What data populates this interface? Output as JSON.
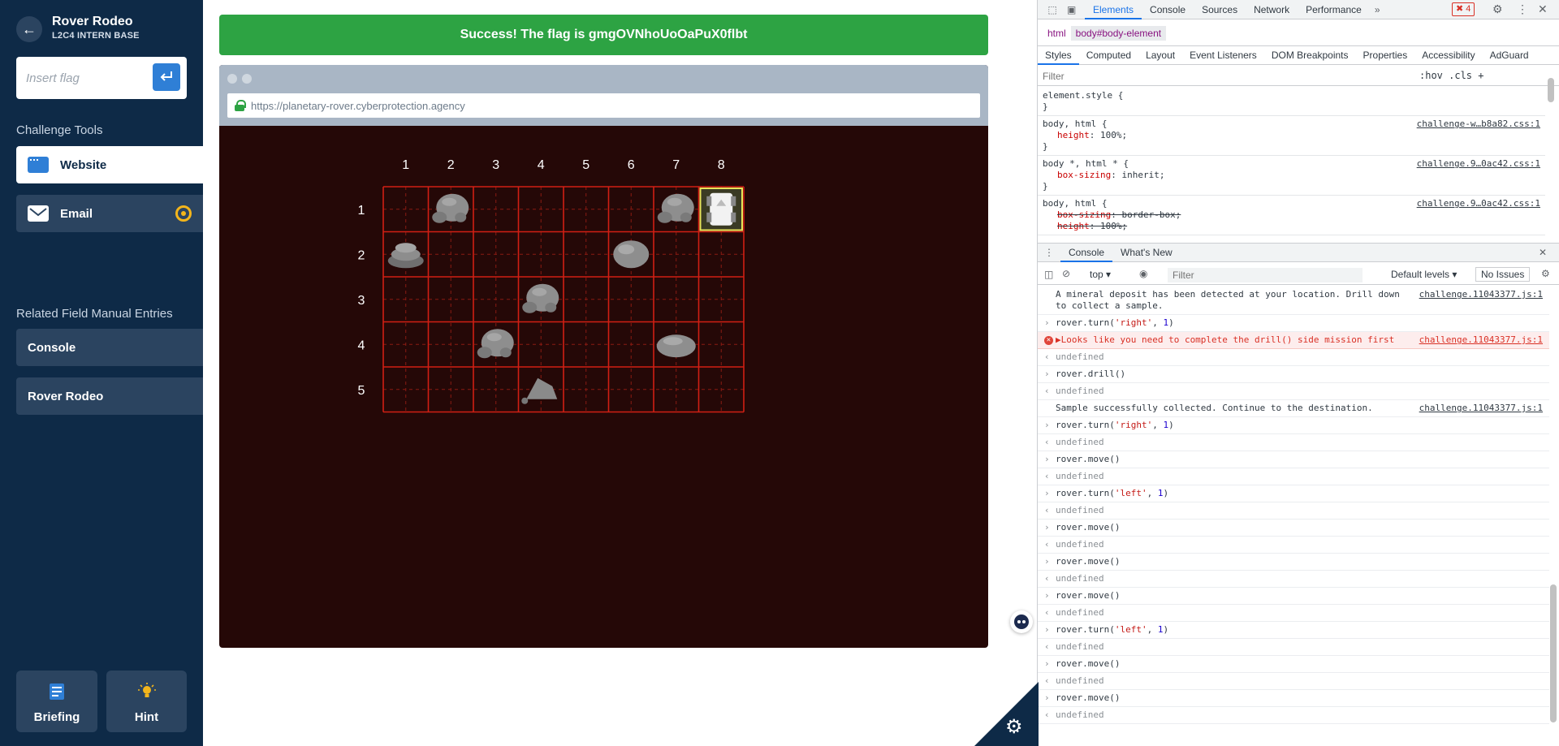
{
  "sidebar": {
    "title": "Rover Rodeo",
    "subtitle": "L2C4 INTERN BASE",
    "flag_placeholder": "Insert flag",
    "tools_heading": "Challenge Tools",
    "tools": [
      {
        "label": "Website",
        "icon": "browser-window-icon"
      },
      {
        "label": "Email",
        "icon": "envelope-icon"
      }
    ],
    "entries_heading": "Related Field Manual Entries",
    "entries": [
      {
        "label": "Console"
      },
      {
        "label": "Rover Rodeo"
      }
    ],
    "briefing_label": "Briefing",
    "hint_label": "Hint"
  },
  "success": {
    "message": "Success! The flag is gmgOVNhoUoOaPuX0flbt",
    "color": "#2da343"
  },
  "browser": {
    "url": "https://planetary-rover.cyberprotection.agency"
  },
  "grid": {
    "columns": [
      "1",
      "2",
      "3",
      "4",
      "5",
      "6",
      "7",
      "8"
    ],
    "rows": [
      "1",
      "2",
      "3",
      "4",
      "5"
    ],
    "rocks": [
      {
        "row": 1,
        "col": 2,
        "kind": "boulder"
      },
      {
        "row": 1,
        "col": 7,
        "kind": "boulder"
      },
      {
        "row": 2,
        "col": 1,
        "kind": "stacked"
      },
      {
        "row": 2,
        "col": 6,
        "kind": "round"
      },
      {
        "row": 3,
        "col": 4,
        "kind": "boulder"
      },
      {
        "row": 4,
        "col": 3,
        "kind": "boulder"
      },
      {
        "row": 4,
        "col": 7,
        "kind": "flat"
      },
      {
        "row": 5,
        "col": 4,
        "kind": "pointy"
      }
    ],
    "rover": {
      "row": 1,
      "col": 8
    }
  },
  "devtools": {
    "tabs": [
      "Elements",
      "Console",
      "Sources",
      "Network",
      "Performance"
    ],
    "active_tab": "Elements",
    "error_count": "4",
    "breadcrumbs": [
      "html",
      "body#body-element"
    ],
    "style_tabs": [
      "Styles",
      "Computed",
      "Layout",
      "Event Listeners",
      "DOM Breakpoints",
      "Properties",
      "Accessibility",
      "AdGuard"
    ],
    "styles_filter_placeholder": "Filter",
    "filter_tools": ":hov  .cls  +",
    "rules": [
      {
        "selector": "element.style {",
        "source": "",
        "props": [],
        "close": "}"
      },
      {
        "selector": "body, html {",
        "source": "challenge-w…b8a82.css:1",
        "props": [
          {
            "k": "height",
            "v": ": 100%;",
            "strike": false
          }
        ],
        "close": "}"
      },
      {
        "selector": "body *, html * {",
        "source": "challenge.9…0ac42.css:1",
        "props": [
          {
            "k": "box-sizing",
            "v": ": inherit;",
            "strike": false
          }
        ],
        "close": "}"
      },
      {
        "selector": "body, html {",
        "source": "challenge.9…0ac42.css:1",
        "props": [
          {
            "k": "box-sizing",
            "v": ": border-box;",
            "strike": true
          },
          {
            "k": "height",
            "v": ": 100%;",
            "strike": true
          }
        ],
        "close": ""
      }
    ],
    "drawer_tabs": [
      "Console",
      "What's New"
    ],
    "context": "top",
    "console_filter_placeholder": "Filter",
    "levels": "Default levels",
    "issues": "No Issues",
    "log": [
      {
        "type": "log",
        "text": "A mineral deposit has been detected at your location. Drill down to collect a sample.",
        "link": "challenge.11043377.js:1"
      },
      {
        "type": "input",
        "text": "rover.turn('right', 1)"
      },
      {
        "type": "error",
        "text": "▶Looks like you need to complete the drill() side mission first",
        "link": "challenge.11043377.js:1"
      },
      {
        "type": "result",
        "text": "undefined"
      },
      {
        "type": "input",
        "text": "rover.drill()"
      },
      {
        "type": "result",
        "text": "undefined"
      },
      {
        "type": "log",
        "text": "Sample successfully collected. Continue to the destination.",
        "link": "challenge.11043377.js:1"
      },
      {
        "type": "input",
        "text": "rover.turn('right', 1)"
      },
      {
        "type": "result",
        "text": "undefined"
      },
      {
        "type": "input",
        "text": "rover.move()"
      },
      {
        "type": "result",
        "text": "undefined"
      },
      {
        "type": "input",
        "text": "rover.turn('left', 1)"
      },
      {
        "type": "result",
        "text": "undefined"
      },
      {
        "type": "input",
        "text": "rover.move()"
      },
      {
        "type": "result",
        "text": "undefined"
      },
      {
        "type": "input",
        "text": "rover.move()"
      },
      {
        "type": "result",
        "text": "undefined"
      },
      {
        "type": "input",
        "text": "rover.move()"
      },
      {
        "type": "result",
        "text": "undefined"
      },
      {
        "type": "input",
        "text": "rover.turn('left', 1)"
      },
      {
        "type": "result",
        "text": "undefined"
      },
      {
        "type": "input",
        "text": "rover.move()"
      },
      {
        "type": "result",
        "text": "undefined"
      },
      {
        "type": "input",
        "text": "rover.move()"
      },
      {
        "type": "result",
        "text": "undefined"
      },
      {
        "type": "prompt",
        "text": ""
      }
    ]
  }
}
